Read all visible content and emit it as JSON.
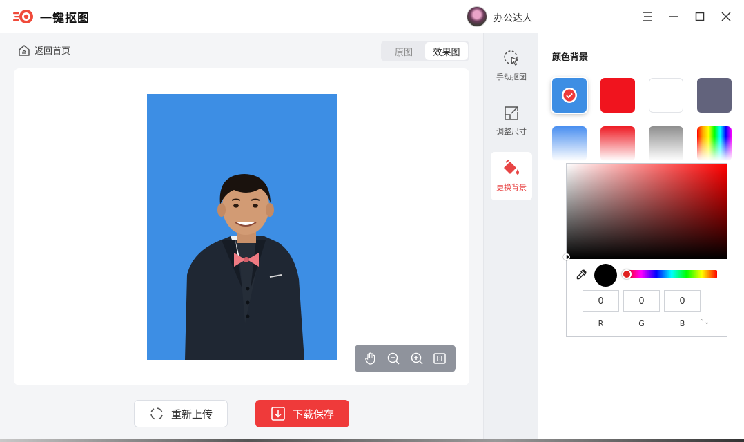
{
  "app": {
    "title": "一键抠图"
  },
  "user": {
    "name": "办公达人"
  },
  "window_controls": {
    "menu_icon": "hamburger-icon",
    "minimize_icon": "minimize-icon",
    "maximize_icon": "maximize-icon",
    "close_icon": "close-icon"
  },
  "left": {
    "back_label": "返回首页",
    "view_tabs": [
      {
        "label": "原图"
      },
      {
        "label": "效果图",
        "active": true
      }
    ],
    "preview_background": "#3d8ee4",
    "zoom_tools": [
      "hand-icon",
      "zoom-out-icon",
      "zoom-in-icon",
      "fit-icon"
    ],
    "reupload_label": "重新上传",
    "download_label": "下载保存"
  },
  "tools": [
    {
      "icon": "cursor-select-icon",
      "label": "手动抠图",
      "active": false
    },
    {
      "icon": "resize-icon",
      "label": "调整尺寸",
      "active": false
    },
    {
      "icon": "paint-bucket-icon",
      "label": "更换背景",
      "active": true
    }
  ],
  "panel": {
    "title": "颜色背景",
    "swatches": [
      {
        "color": "#3d8ee4",
        "selected": true
      },
      {
        "color": "#f0141e"
      },
      {
        "color": "#ffffff"
      },
      {
        "color": "#62637c"
      },
      {
        "color": "gradient-blue"
      },
      {
        "color": "gradient-red"
      },
      {
        "color": "gradient-gray"
      },
      {
        "color": "gradient-rainbow"
      }
    ],
    "picker": {
      "r": "0",
      "g": "0",
      "b": "0",
      "labels": {
        "r": "R",
        "g": "G",
        "b": "B"
      },
      "mode_toggle": "⌃⌄",
      "current_color": "#000000",
      "hue_color": "#ff0000"
    }
  },
  "colors": {
    "accent": "#ef3a3a",
    "active_tool": "#e84545"
  }
}
